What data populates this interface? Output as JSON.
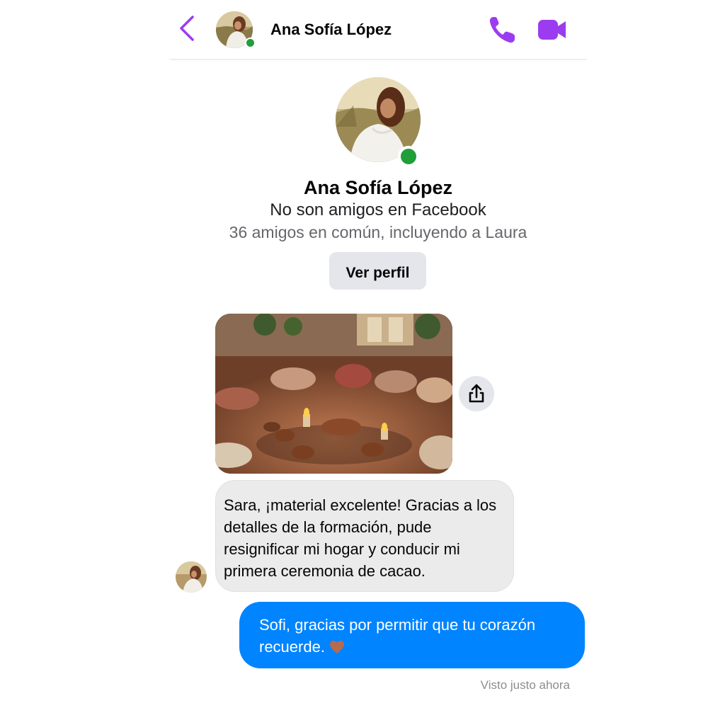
{
  "header": {
    "contact_name": "Ana Sofía López",
    "back_icon": "chevron-left-icon",
    "call_icon": "phone-icon",
    "video_icon": "video-camera-icon",
    "accent_color": "#9b3cf0",
    "online_color": "#1f9e3a"
  },
  "profile": {
    "name": "Ana Sofía López",
    "friend_status": "No son amigos en Facebook",
    "mutual_friends": "36 amigos en común, incluyendo a Laura",
    "view_profile_label": "Ver perfil"
  },
  "messages": [
    {
      "type": "image",
      "from": "contact",
      "share_icon": "share-icon"
    },
    {
      "type": "text",
      "from": "contact",
      "text": "Sara, ¡material excelente! Gracias a los detalles de la formación, pude resignificar  mi hogar y conducir mi primera ceremonia de cacao."
    },
    {
      "type": "text",
      "from": "me",
      "text": "Sofi, gracias por permitir que tu corazón recuerde.",
      "emoji": "heart-icon"
    }
  ],
  "seen_status": "Visto justo ahora",
  "colors": {
    "outgoing_bubble": "#0084ff",
    "incoming_bubble": "#ebebeb",
    "heart": "#b86a4e"
  }
}
